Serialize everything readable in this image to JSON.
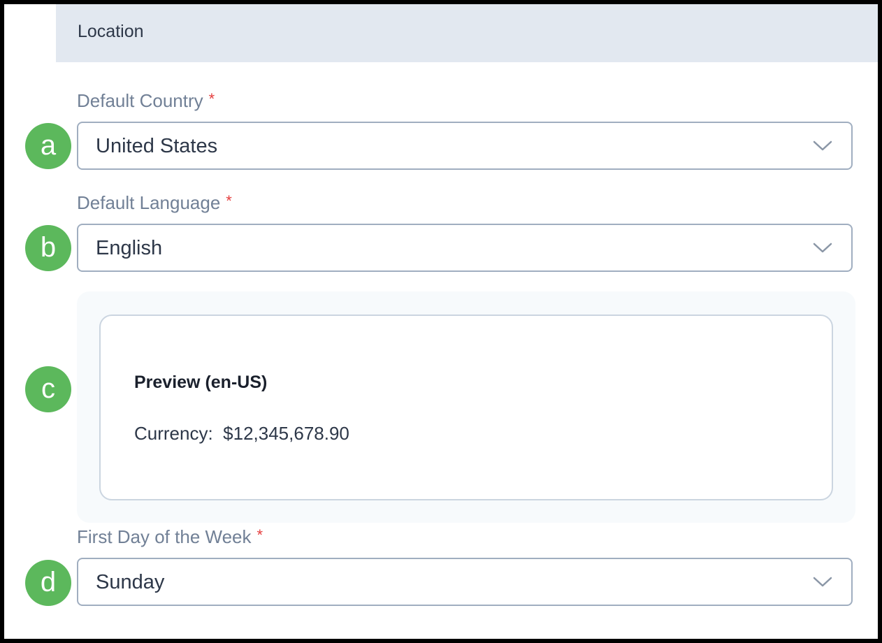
{
  "section": {
    "title": "Location"
  },
  "fields": {
    "country": {
      "label": "Default Country",
      "required_mark": "*",
      "value": "United States",
      "marker": "a"
    },
    "language": {
      "label": "Default Language",
      "required_mark": "*",
      "value": "English",
      "marker": "b"
    },
    "first_day": {
      "label": "First Day of the Week",
      "required_mark": "*",
      "value": "Sunday",
      "marker": "d"
    }
  },
  "preview": {
    "marker": "c",
    "title": "Preview (en-US)",
    "currency_label": "Currency:",
    "currency_value": "$12,345,678.90"
  },
  "icons": {
    "dropdown": "chevron-down-icon"
  },
  "colors": {
    "header_bg": "#e2e8f0",
    "label": "#718096",
    "required": "#e53e3e",
    "marker": "#5cb85c",
    "border": "#a0aec0",
    "preview_bg": "#f7fafc"
  }
}
